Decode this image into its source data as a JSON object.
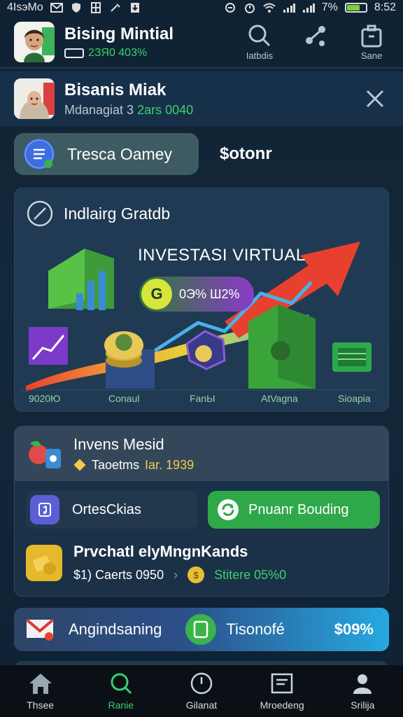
{
  "status_bar": {
    "carrier": "4IsэMo",
    "battery": "7%",
    "battery_level": 0.7,
    "time": "8:52"
  },
  "header": {
    "title": "Bising Mintial",
    "subtitle": "2ЗЯ0 403%",
    "actions": [
      {
        "label": "Iatbdis",
        "icon": "search-icon"
      },
      {
        "label": "",
        "icon": "share-icon"
      },
      {
        "label": "Sane",
        "icon": "bag-icon"
      }
    ]
  },
  "notification": {
    "title": "Bisanis Miak",
    "subtitle_prefix": "Mdanagiat 3",
    "subtitle_accent": "2ars 0040"
  },
  "tabs": {
    "active": "Tresca Oamey",
    "inactive": "$otonr"
  },
  "chart_card": {
    "title": "Indlairg Gratdb",
    "banner": "INVESTASI VIRTUAL",
    "pill_icon": "G",
    "pill_text": "0Э% Ш2%",
    "axis_labels": [
      "9020Ю",
      "Conaul",
      "FanЫ",
      "AtVagna",
      "Sioapia"
    ],
    "colors": {
      "arrow": "#e8402f",
      "rainbow_start": "#e8402f",
      "rainbow_end": "#4ab0e8"
    }
  },
  "invest_card": {
    "title": "Invens Mesid",
    "sub_label": "Taoetms",
    "sub_value": "Іаr. 1939",
    "btn_left": "OrtesCkias",
    "btn_right": "Pnuanr Bouding",
    "foot_title": "Prvchatl elyMngnKands",
    "foot_sub_left": "$1) Caerts 0950",
    "foot_sub_right": "Stitere 05%0",
    "mini_coin": "$"
  },
  "promo": {
    "label": "Angindsaning",
    "label2": "Tisonofé",
    "value": "$09%"
  },
  "bottom_nav": [
    {
      "label": "Thsee",
      "icon": "home-icon"
    },
    {
      "label": "Ranie",
      "icon": "search-icon"
    },
    {
      "label": "Gilanat",
      "icon": "compass-icon"
    },
    {
      "label": "Mroedeng",
      "icon": "mail-icon"
    },
    {
      "label": "Srilija",
      "icon": "profile-icon"
    }
  ],
  "active_nav": 1
}
